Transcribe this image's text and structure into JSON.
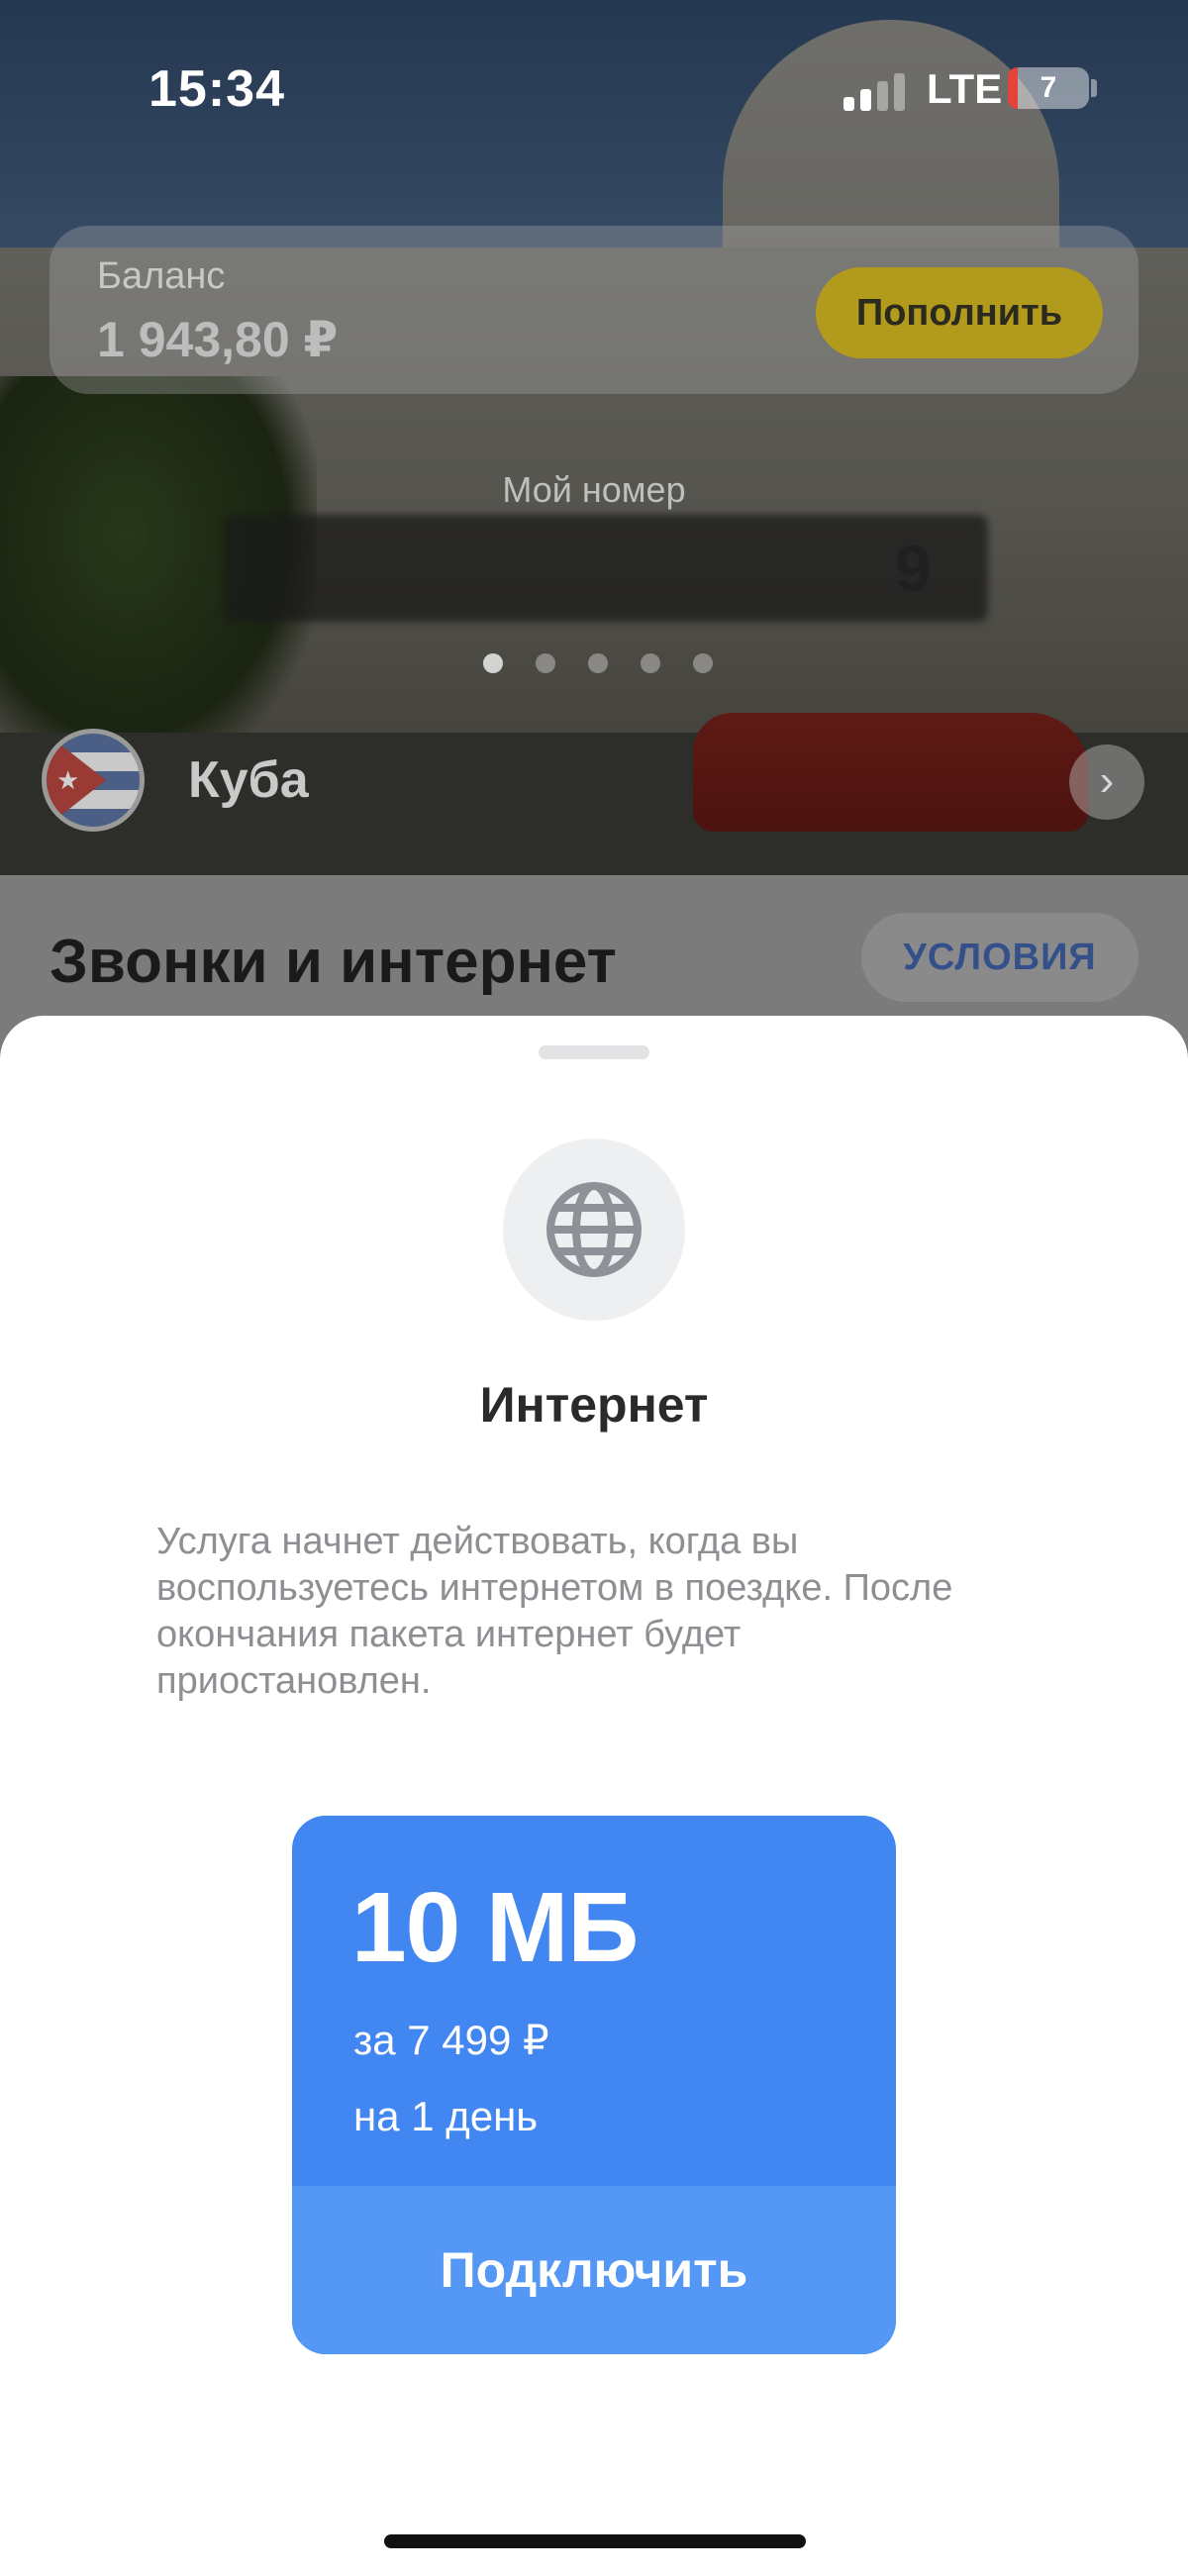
{
  "status_bar": {
    "time": "15:34",
    "network": "LTE",
    "battery": "7"
  },
  "balance": {
    "label": "Баланс",
    "value": "1 943,80 ₽",
    "topup_label": "Пополнить"
  },
  "phone": {
    "label": "Мой номер",
    "visible_tail": "9"
  },
  "country": {
    "name": "Куба"
  },
  "section": {
    "title": "Звонки и интернет",
    "terms_label": "УСЛОВИЯ"
  },
  "sheet": {
    "icon": "globe-icon",
    "title": "Интернет",
    "description": "Услуга начнет действовать, когда вы воспользуетесь интернетом в поездке. После окончания пакета интернет будет приостановлен.",
    "tariff": {
      "volume": "10 МБ",
      "price": "за 7 499 ₽",
      "period": "на 1 день",
      "connect_label": "Подключить"
    }
  },
  "colors": {
    "accent_blue": "#4287f1",
    "topup_yellow": "#f7d51c"
  }
}
